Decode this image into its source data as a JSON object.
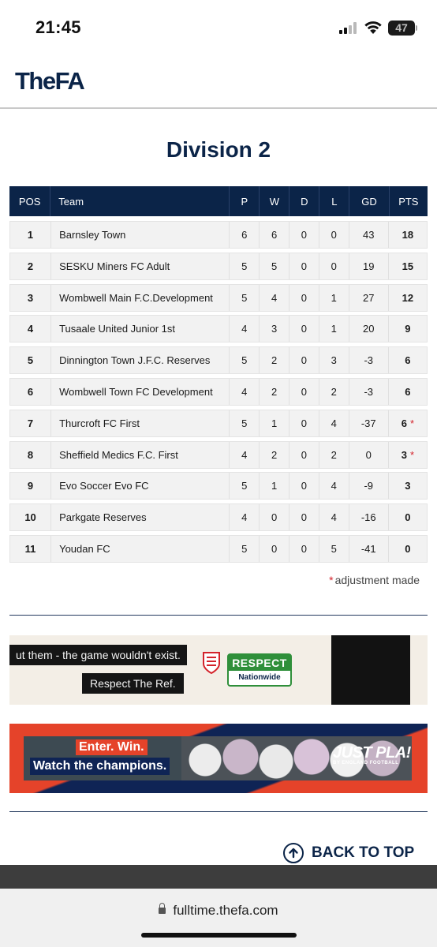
{
  "status_bar": {
    "time": "21:45",
    "battery": "47"
  },
  "header": {
    "logo": "TheFA"
  },
  "page_title": "Division 2",
  "table": {
    "columns": [
      "POS",
      "Team",
      "P",
      "W",
      "D",
      "L",
      "GD",
      "PTS"
    ],
    "rows": [
      {
        "pos": "1",
        "team": "Barnsley Town",
        "p": "6",
        "w": "6",
        "d": "0",
        "l": "0",
        "gd": "43",
        "pts": "18",
        "adjusted": false
      },
      {
        "pos": "2",
        "team": "SESKU Miners FC Adult",
        "p": "5",
        "w": "5",
        "d": "0",
        "l": "0",
        "gd": "19",
        "pts": "15",
        "adjusted": false
      },
      {
        "pos": "3",
        "team": "Wombwell Main F.C.Development",
        "p": "5",
        "w": "4",
        "d": "0",
        "l": "1",
        "gd": "27",
        "pts": "12",
        "adjusted": false
      },
      {
        "pos": "4",
        "team": "Tusaale United Junior 1st",
        "p": "4",
        "w": "3",
        "d": "0",
        "l": "1",
        "gd": "20",
        "pts": "9",
        "adjusted": false
      },
      {
        "pos": "5",
        "team": "Dinnington Town J.F.C. Reserves",
        "p": "5",
        "w": "2",
        "d": "0",
        "l": "3",
        "gd": "-3",
        "pts": "6",
        "adjusted": false
      },
      {
        "pos": "6",
        "team": "Wombwell Town FC Development",
        "p": "4",
        "w": "2",
        "d": "0",
        "l": "2",
        "gd": "-3",
        "pts": "6",
        "adjusted": false
      },
      {
        "pos": "7",
        "team": "Thurcroft FC First",
        "p": "5",
        "w": "1",
        "d": "0",
        "l": "4",
        "gd": "-37",
        "pts": "6",
        "adjusted": true
      },
      {
        "pos": "8",
        "team": "Sheffield Medics F.C. First",
        "p": "4",
        "w": "2",
        "d": "0",
        "l": "2",
        "gd": "0",
        "pts": "3",
        "adjusted": true
      },
      {
        "pos": "9",
        "team": "Evo Soccer Evo FC",
        "p": "5",
        "w": "1",
        "d": "0",
        "l": "4",
        "gd": "-9",
        "pts": "3",
        "adjusted": false
      },
      {
        "pos": "10",
        "team": "Parkgate Reserves",
        "p": "4",
        "w": "0",
        "d": "0",
        "l": "4",
        "gd": "-16",
        "pts": "0",
        "adjusted": false
      },
      {
        "pos": "11",
        "team": "Youdan FC",
        "p": "5",
        "w": "0",
        "d": "0",
        "l": "5",
        "gd": "-41",
        "pts": "0",
        "adjusted": false
      }
    ],
    "adjust_marker": "*",
    "adjust_note": "adjustment made"
  },
  "ads": {
    "respect": {
      "line1": "ut them - the game wouldn't exist.",
      "line2": "Respect The Ref.",
      "badge_top": "RESPECT",
      "badge_bottom": "Nationwide"
    },
    "justplay": {
      "line1": "Enter. Win.",
      "line2": "Watch the champions.",
      "brand": "JUST PLA!",
      "brand_sub": "BY ENGLAND FOOTBALL"
    }
  },
  "back_to_top": "BACK TO TOP",
  "browser": {
    "url": "fulltime.thefa.com"
  },
  "colors": {
    "navy": "#0b2448",
    "adjust_red": "#d4232b",
    "respect_green": "#2f8f3a",
    "justplay_red": "#e5432a"
  },
  "icons": [
    "signal-icon",
    "wifi-icon",
    "battery-icon",
    "england-crest-icon",
    "arrow-up-circle-icon",
    "lock-icon"
  ]
}
